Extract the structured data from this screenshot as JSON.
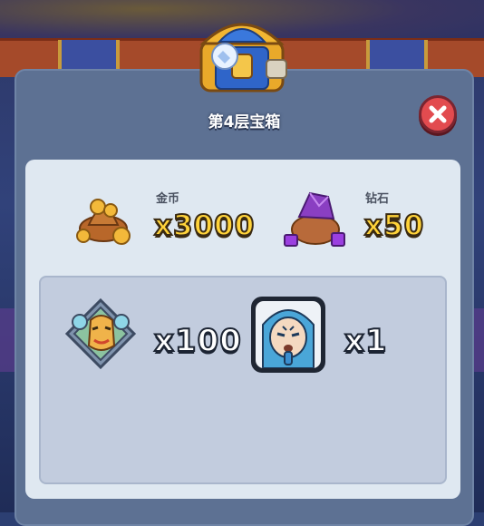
{
  "dialog": {
    "title": "第4层宝箱"
  },
  "rewards": {
    "gold": {
      "label": "金币",
      "amount": "x3000",
      "icon": "gold-coin-bag-icon"
    },
    "gems": {
      "label": "钻石",
      "amount": "x50",
      "icon": "gem-bag-icon"
    }
  },
  "items": [
    {
      "icon": "mask-puzzle-piece-icon",
      "amount": "x100"
    },
    {
      "icon": "hero-portrait-card-icon",
      "amount": "x1"
    }
  ],
  "colors": {
    "panel": "#5d7193",
    "card": "#dfe8f1",
    "inner_box": "#c2ccde",
    "close_button": "#e24b4f",
    "amount_gold": "#ffd33a"
  }
}
